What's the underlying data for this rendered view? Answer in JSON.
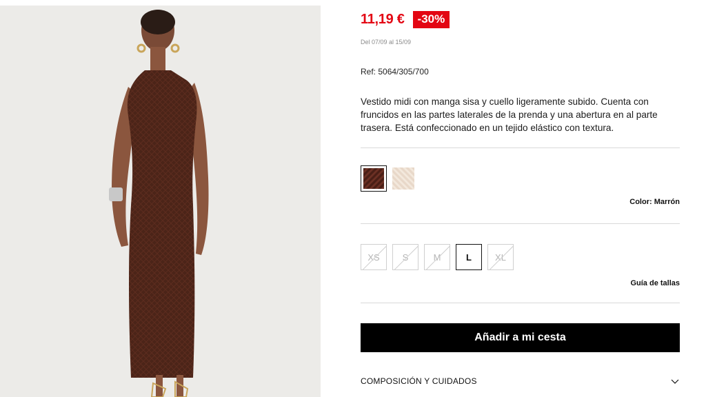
{
  "product": {
    "price": "11,19 €",
    "discount": "-30%",
    "promo_dates": "Del 07/09 al 15/09",
    "reference": "Ref: 5064/305/700",
    "description": "Vestido midi con manga sisa y cuello ligeramente subido. Cuenta con fruncidos en las partes laterales de la prenda y una abertura en al parte trasera. Está confeccionado en un tejido elástico con textura."
  },
  "colors": {
    "label_prefix": "Color:",
    "selected_name": "Marrón",
    "swatches": [
      {
        "name": "brown",
        "hex": "#5a2419",
        "selected": true
      },
      {
        "name": "beige",
        "hex": "#ecdfd2",
        "selected": false
      }
    ]
  },
  "sizes": {
    "options": [
      {
        "label": "XS",
        "available": false
      },
      {
        "label": "S",
        "available": false
      },
      {
        "label": "M",
        "available": false
      },
      {
        "label": "L",
        "available": true
      },
      {
        "label": "XL",
        "available": false
      }
    ],
    "guide_label": "Guía de tallas"
  },
  "actions": {
    "add_to_cart": "Añadir a mi cesta"
  },
  "accordion": {
    "composition_label": "COMPOSICIÓN Y CUIDADOS"
  },
  "theme": {
    "accent": "#e30613",
    "button_bg": "#000000"
  }
}
